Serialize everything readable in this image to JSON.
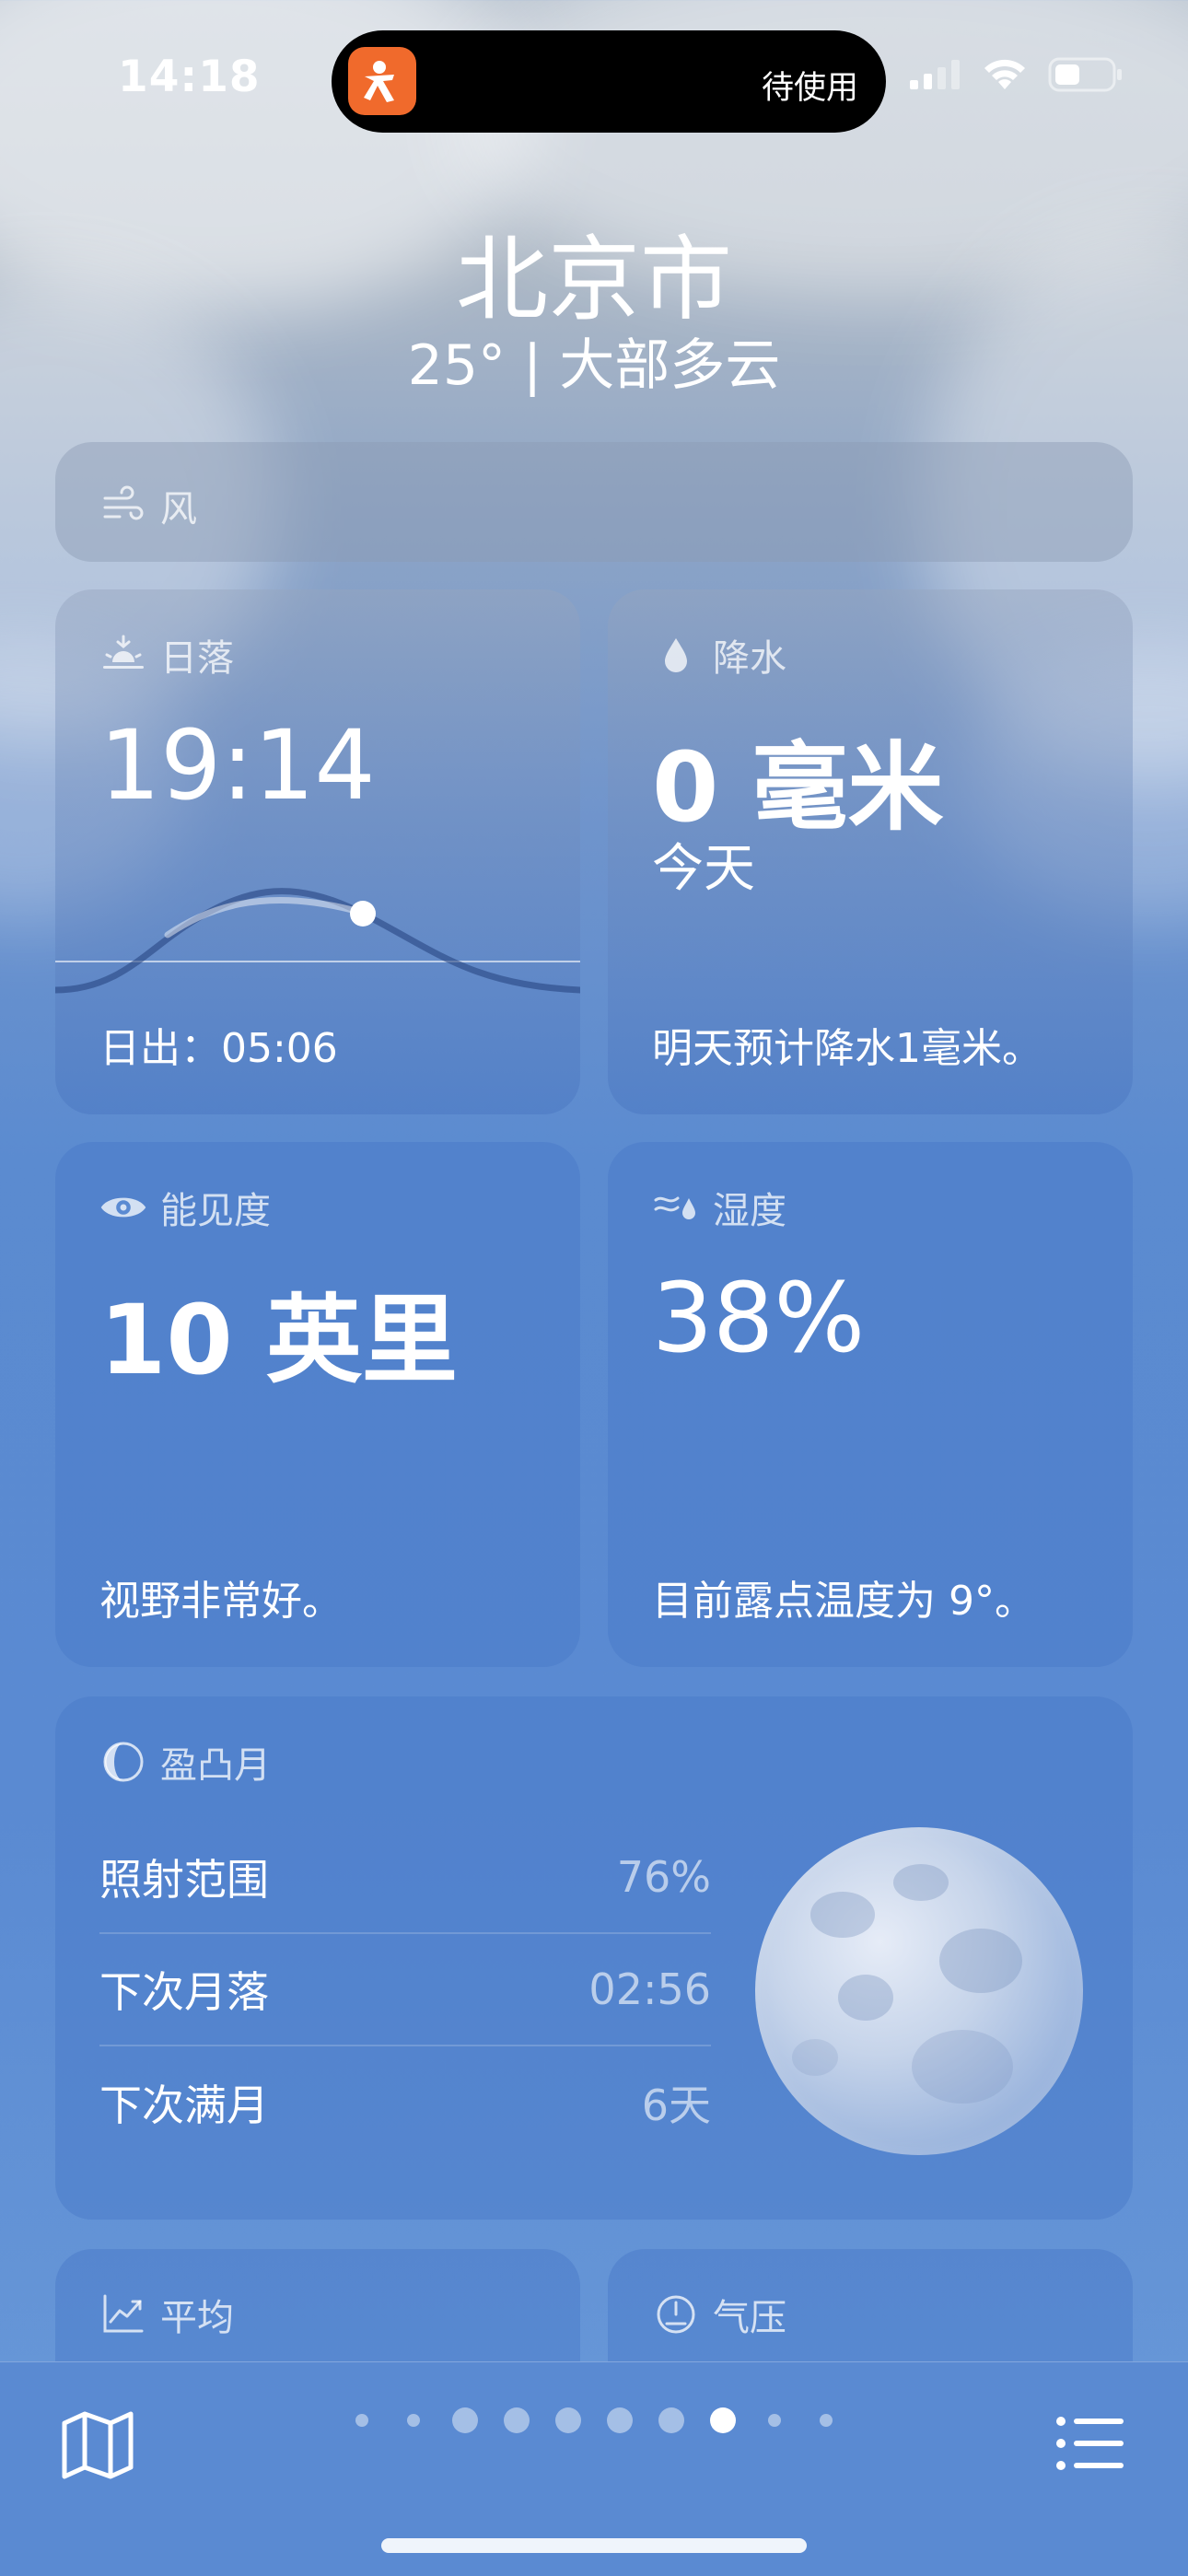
{
  "status_bar": {
    "time": "14:18",
    "island_text": "待使用"
  },
  "header": {
    "city": "北京市",
    "summary": "25° | 大部多云"
  },
  "wind": {
    "title": "风"
  },
  "sunset": {
    "title": "日落",
    "value": "19:14",
    "sunrise": "日出：05:06"
  },
  "precipitation": {
    "title": "降水",
    "value": "0 毫米",
    "period": "今天",
    "forecast": "明天预计降水1毫米。"
  },
  "visibility": {
    "title": "能见度",
    "value": "10 英里",
    "desc": "视野非常好。"
  },
  "humidity": {
    "title": "湿度",
    "value": "38%",
    "desc": "目前露点温度为 9°。"
  },
  "moon": {
    "title": "盈凸月",
    "rows": [
      {
        "label": "照射范围",
        "value": "76%"
      },
      {
        "label": "下次月落",
        "value": "02:56"
      },
      {
        "label": "下次满月",
        "value": "6天"
      }
    ]
  },
  "averages": {
    "title": "平均"
  },
  "pressure": {
    "title": "气压"
  },
  "page_indicator": {
    "total": 10,
    "active_index": 7
  },
  "colors": {
    "app_icon": "#f06a2c",
    "background_bottom": "#5a8ad2"
  }
}
